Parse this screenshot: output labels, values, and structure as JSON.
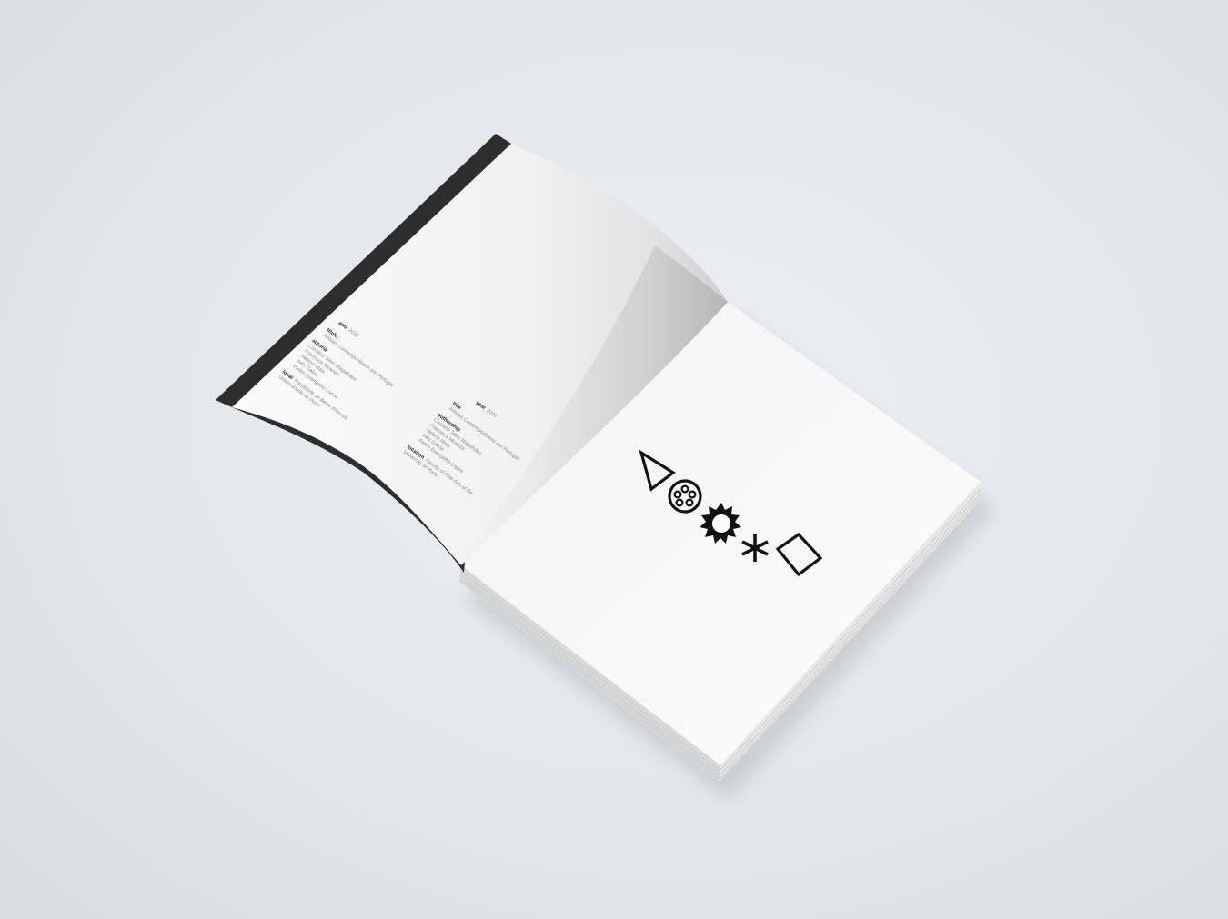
{
  "scene": {
    "description_colors": {
      "background": "#e3e6ea",
      "page": "#f7f7f7",
      "spine_band": "#2e2e2e",
      "ink": "#111111"
    }
  },
  "left_page": {
    "portuguese": {
      "year_label": "ano",
      "year_value": "2022",
      "title_label": "título",
      "title_value": "Artistas Contemporâneas em Portugal",
      "authors_label": "autoria",
      "authors": [
        "Carolina Teles Magalhães",
        "Francisca Miranda",
        "Helena Maia",
        "Inês Galiza",
        "Pedro Evangelho Lopes"
      ],
      "location_label": "local",
      "location_lines": [
        "Faculdade de Belas Artes da",
        "Universidade do Porto"
      ]
    },
    "english": {
      "year_label": "year",
      "year_value": "2022",
      "title_label": "title",
      "title_value": "Artistas Contemporâneas em Portugal",
      "authors_label": "authorship",
      "authors": [
        "Carolina Teles Magalhães",
        "Francisca Miranda",
        "Helena Maia",
        "Inês Galiza",
        "Pedro Evangelho Lopes"
      ],
      "location_label": "location",
      "location_lines": [
        "Faculty of Fine Arts of the",
        "University of Porto"
      ]
    }
  },
  "right_page": {
    "symbols": [
      "triangle-icon",
      "film-reel-icon",
      "starburst-icon",
      "asterisk-icon",
      "rectangle-icon"
    ]
  }
}
